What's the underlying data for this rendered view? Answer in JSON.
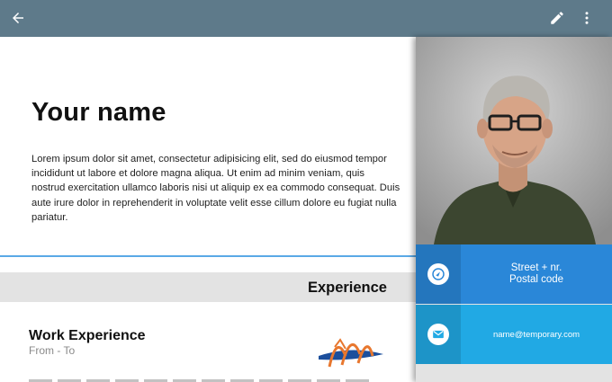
{
  "toolbar": {
    "back_icon": "arrow-back-icon",
    "edit_icon": "pencil-icon",
    "more_icon": "more-vert-icon",
    "background_color": "#5e7a8a"
  },
  "profile": {
    "name": "Your name",
    "bio": "Lorem ipsum dolor sit amet, consectetur adipisicing elit, sed do eiusmod tempor incididunt ut labore et dolore magna aliqua. Ut enim ad minim veniam, quis nostrud exercitation ullamco laboris nisi ut aliquip ex ea commodo consequat. Duis aute irure dolor in reprehenderit in voluptate velit esse cillum dolore eu fugiat nulla pariatur."
  },
  "experience": {
    "section_title": "Experience",
    "items": [
      {
        "title": "Work Experience",
        "dates": "From - To"
      }
    ]
  },
  "contact": {
    "address_line1": "Street + nr.",
    "address_line2": "Postal code",
    "email": "name@temporary.com",
    "address_color": "#2a87d8",
    "email_color": "#21a9e4"
  }
}
